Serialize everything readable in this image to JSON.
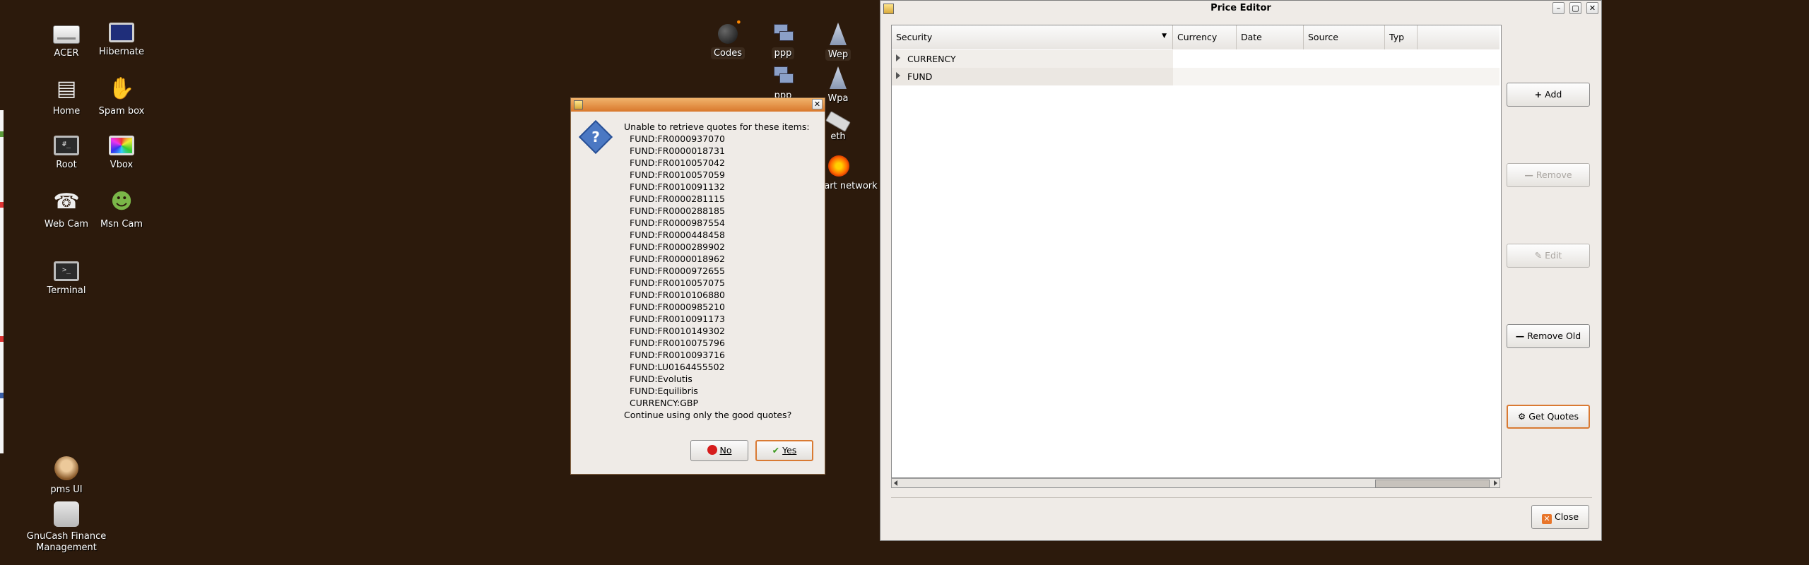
{
  "desktop": {
    "icons": [
      {
        "label": "ACER",
        "icon": "drive-icon"
      },
      {
        "label": "Hibernate",
        "icon": "monitor-icon"
      },
      {
        "label": "Home",
        "icon": "folder-icon"
      },
      {
        "label": "Spam box",
        "icon": "hand-icon"
      },
      {
        "label": "Root",
        "icon": "terminal-icon"
      },
      {
        "label": "Vbox",
        "icon": "virtualbox-icon"
      },
      {
        "label": "Web Cam",
        "icon": "webcam-icon"
      },
      {
        "label": "Msn Cam",
        "icon": "msn-icon"
      },
      {
        "label": "Terminal",
        "icon": "terminal-icon"
      },
      {
        "label": "pms UI",
        "icon": "monkey-icon"
      },
      {
        "label": "GnuCash Finance Management",
        "icon": "gnucash-icon"
      },
      {
        "label": "Codes",
        "icon": "bomb-icon"
      },
      {
        "label": "ppp",
        "icon": "network-icon"
      },
      {
        "label": "Wep",
        "icon": "wireless-tower-icon"
      },
      {
        "label": "ppp",
        "icon": "network-icon"
      },
      {
        "label": "Wpa",
        "icon": "wireless-tower-icon"
      },
      {
        "label": "eth",
        "icon": "usb-icon"
      },
      {
        "label": "art network",
        "icon": "flame-icon"
      }
    ]
  },
  "dialog": {
    "message": "Unable to retrieve quotes for these items:",
    "items": [
      "FUND:FR0000937070",
      "FUND:FR0000018731",
      "FUND:FR0010057042",
      "FUND:FR0010057059",
      "FUND:FR0010091132",
      "FUND:FR0000281115",
      "FUND:FR0000288185",
      "FUND:FR0000987554",
      "FUND:FR0000448458",
      "FUND:FR0000289902",
      "FUND:FR0000018962",
      "FUND:FR0000972655",
      "FUND:FR0010057075",
      "FUND:FR0010106880",
      "FUND:FR0000985210",
      "FUND:FR0010091173",
      "FUND:FR0010149302",
      "FUND:FR0010075796",
      "FUND:FR0010093716",
      "FUND:LU0164455502",
      "FUND:Evolutis",
      "FUND:Equilibris",
      "CURRENCY:GBP"
    ],
    "question": "Continue using only the good quotes?",
    "no_label": "No",
    "yes_label": "Yes"
  },
  "price_editor": {
    "title": "Price Editor",
    "columns": [
      "Security",
      "Currency",
      "Date",
      "Source",
      "Typ"
    ],
    "rows": [
      "CURRENCY",
      "FUND"
    ],
    "buttons": {
      "add": "Add",
      "remove": "Remove",
      "edit": "Edit",
      "remove_old": "Remove Old",
      "get_quotes": "Get Quotes",
      "close": "Close"
    }
  }
}
